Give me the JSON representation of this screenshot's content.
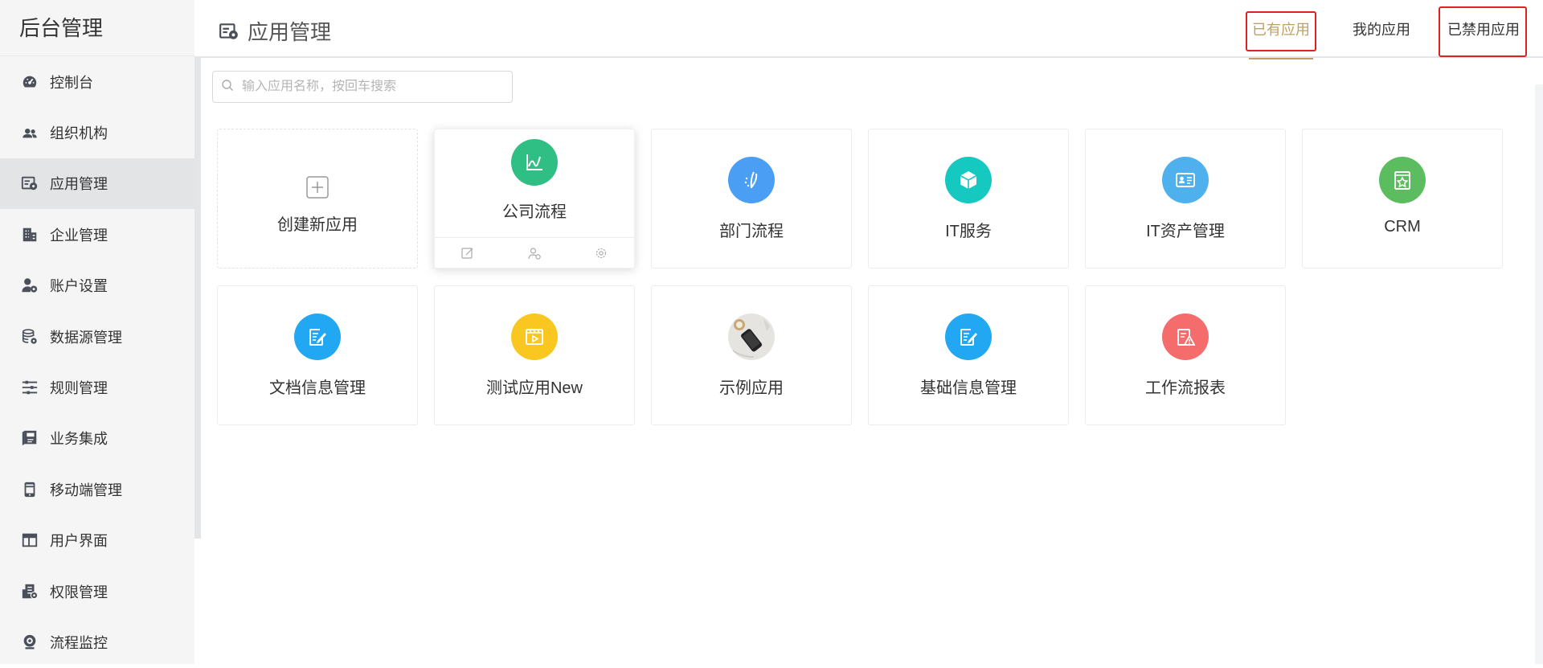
{
  "sidebar": {
    "title": "后台管理",
    "items": [
      {
        "label": "控制台",
        "icon": "dashboard-icon"
      },
      {
        "label": "组织机构",
        "icon": "users-icon"
      },
      {
        "label": "应用管理",
        "icon": "app-settings-icon",
        "active": true
      },
      {
        "label": "企业管理",
        "icon": "building-icon"
      },
      {
        "label": "账户设置",
        "icon": "user-settings-icon"
      },
      {
        "label": "数据源管理",
        "icon": "database-icon"
      },
      {
        "label": "规则管理",
        "icon": "sliders-icon"
      },
      {
        "label": "业务集成",
        "icon": "book-icon"
      },
      {
        "label": "移动端管理",
        "icon": "mobile-icon"
      },
      {
        "label": "用户界面",
        "icon": "layout-icon"
      },
      {
        "label": "权限管理",
        "icon": "permission-icon"
      },
      {
        "label": "流程监控",
        "icon": "monitor-icon"
      }
    ]
  },
  "header": {
    "title": "应用管理",
    "tabs": [
      {
        "label": "已有应用",
        "active": true
      },
      {
        "label": "我的应用"
      },
      {
        "label": "已禁用应用"
      }
    ]
  },
  "search": {
    "placeholder": "输入应用名称，按回车搜索",
    "value": ""
  },
  "cards": [
    {
      "name": "创建新应用",
      "type": "create"
    },
    {
      "name": "公司流程",
      "icon": "chart-line-icon",
      "color": "#2fbf85"
    },
    {
      "name": "部门流程",
      "icon": "flow-icon",
      "color": "#4a9ff5"
    },
    {
      "name": "IT服务",
      "icon": "cube-icon",
      "color": "#15c9c0"
    },
    {
      "name": "IT资产管理",
      "icon": "id-card-icon",
      "color": "#4fb0ee"
    },
    {
      "name": "CRM",
      "icon": "star-box-icon",
      "color": "#5bbd60"
    },
    {
      "name": "文档信息管理",
      "icon": "edit-doc-icon",
      "color": "#22a8f2"
    },
    {
      "name": "测试应用New",
      "icon": "video-icon",
      "color": "#f9c71f"
    },
    {
      "name": "示例应用",
      "icon": "photo-icon"
    },
    {
      "name": "基础信息管理",
      "icon": "edit-doc-icon",
      "color": "#22a8f2"
    },
    {
      "name": "工作流报表",
      "icon": "warning-doc-icon",
      "color": "#f56c6c"
    }
  ],
  "colors": {
    "accent": "#c0a062",
    "highlight_box": "#e02020"
  }
}
